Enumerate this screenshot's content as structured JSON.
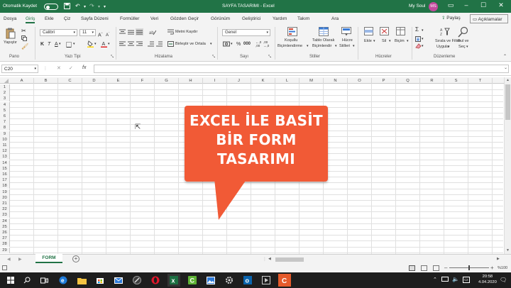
{
  "titlebar": {
    "autosave_label": "Otomatik Kaydet",
    "doc_title": "SAYFA TASARIMI  -  Excel",
    "user_name": "My Soul",
    "user_initials": "MS"
  },
  "ribbon_tabs": [
    "Dosya",
    "Giriş",
    "Ekle",
    "Çiz",
    "Sayfa Düzeni",
    "Formüller",
    "Veri",
    "Gözden Geçir",
    "Görünüm",
    "Geliştirici",
    "Yardım",
    "Takım",
    "Ara"
  ],
  "ribbon_actions": {
    "share": "Paylaş",
    "comments": "Açıklamalar"
  },
  "ribbon": {
    "paste": "Yapıştır",
    "font_name": "Calibri",
    "font_size": "11",
    "wrap_text": "Metni Kaydır",
    "merge_center": "Birleştir ve Ortala",
    "number_format": "Genel",
    "cond_format": [
      "Koşullu",
      "Biçimlendirme"
    ],
    "format_table": [
      "Tablo Olarak",
      "Biçimlendir"
    ],
    "cell_styles": [
      "Hücre",
      "Stilleri"
    ],
    "insert": "Ekle",
    "delete": "Sil",
    "format": "Biçim",
    "sort_filter": [
      "Sırala ve Filtre",
      "Uygula"
    ],
    "find_select": [
      "Bul ve",
      "Seç"
    ],
    "group_labels": {
      "clipboard": "Pano",
      "font": "Yazı Tipi",
      "alignment": "Hizalama",
      "number": "Sayı",
      "styles": "Stiller",
      "cells": "Hücreler",
      "editing": "Düzenleme"
    }
  },
  "formula_bar": {
    "name_box": "C20",
    "fx": "fx",
    "formula": ""
  },
  "columns": [
    "A",
    "B",
    "C",
    "D",
    "E",
    "F",
    "G",
    "H",
    "I",
    "J",
    "K",
    "L",
    "M",
    "N",
    "O",
    "P",
    "Q",
    "R",
    "S",
    "T"
  ],
  "rows": [
    "1",
    "2",
    "3",
    "4",
    "5",
    "6",
    "7",
    "8",
    "9",
    "10",
    "11",
    "12",
    "13",
    "14",
    "15",
    "16",
    "17",
    "18",
    "19",
    "20",
    "21",
    "22",
    "23",
    "24",
    "25",
    "26",
    "27",
    "28",
    "29"
  ],
  "sheet_tabs": [
    "FORM"
  ],
  "status": {
    "zoom": "%100"
  },
  "overlay": {
    "line1": "EXCEL İLE BASİT",
    "line2": "BİR FORM",
    "line3": "TASARIMI"
  },
  "taskbar": {
    "time": "20:58",
    "date": "4.04.2020"
  },
  "colors": {
    "excel_green": "#217346",
    "bubble": "#f15a36",
    "taskbar": "#1e1e1e"
  }
}
